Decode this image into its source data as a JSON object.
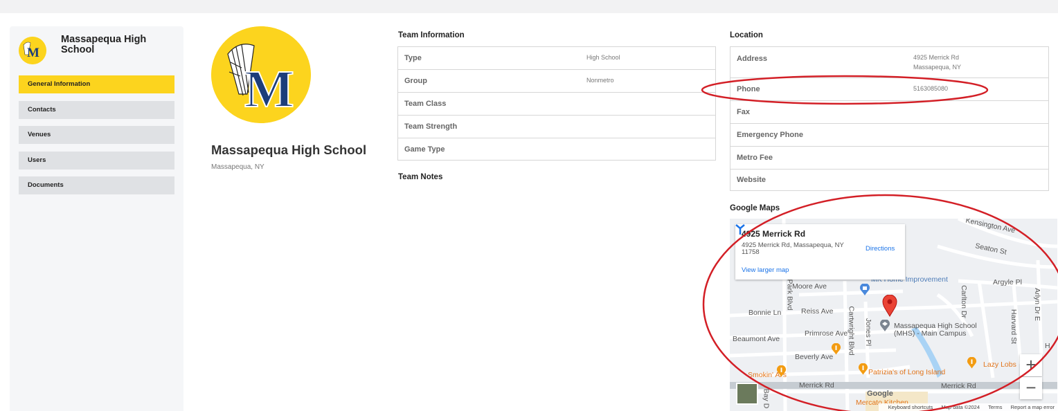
{
  "sidebar": {
    "title": "Massapequa High School",
    "items": [
      {
        "label": "General Information",
        "active": true
      },
      {
        "label": "Contacts",
        "active": false
      },
      {
        "label": "Venues",
        "active": false
      },
      {
        "label": "Users",
        "active": false
      },
      {
        "label": "Documents",
        "active": false
      }
    ]
  },
  "profile": {
    "name": "Massapequa High School",
    "city": "Massapequa, NY"
  },
  "team_info": {
    "title": "Team Information",
    "rows": [
      {
        "label": "Type",
        "value": "High School"
      },
      {
        "label": "Group",
        "value": "Nonmetro"
      },
      {
        "label": "Team Class",
        "value": ""
      },
      {
        "label": "Team Strength",
        "value": ""
      },
      {
        "label": "Game Type",
        "value": ""
      }
    ]
  },
  "team_notes": {
    "title": "Team Notes"
  },
  "location": {
    "title": "Location",
    "rows": [
      {
        "label": "Address",
        "value": "4925 Merrick Rd",
        "value2": "Massapequa, NY"
      },
      {
        "label": "Phone",
        "value": "5163085080"
      },
      {
        "label": "Fax",
        "value": ""
      },
      {
        "label": "Emergency Phone",
        "value": ""
      },
      {
        "label": "Metro Fee",
        "value": ""
      },
      {
        "label": "Website",
        "value": ""
      }
    ]
  },
  "map": {
    "title": "Google Maps",
    "card_title": "4925 Merrick Rd",
    "card_address": "4925 Merrick Rd, Massapequa, NY 11758",
    "directions": "Directions",
    "larger_map": "View larger map",
    "google": "Google",
    "labels": {
      "kensington": "Kensington Ave",
      "seaton": "Seaton St",
      "mk": "MK Home Improvement",
      "argyle": "Argyle Pl",
      "moore": "Moore Ave",
      "park": "Park Blvd",
      "carlton": "Carlton Dr",
      "arlyn": "Arlyn Dr E",
      "bonnie": "Bonnie Ln",
      "reiss": "Reiss Ave",
      "cartwright": "Cartwright Blvd",
      "jones": "Jones Pl",
      "mhs1": "Massapequa High School",
      "mhs2": "(MHS) - Main Campus",
      "harvard": "Harvard St",
      "beaumont": "Beaumont Ave",
      "primrose": "Primrose Ave",
      "beverly": "Beverly Ave",
      "lazy": "Lazy Lobs",
      "smokin": "Smokin' Al's",
      "patrizia": "Patrizia's of Long Island",
      "merrick1": "Merrick Rd",
      "merrick2": "Merrick Rd",
      "bay": "Bay D",
      "mercato": "Mercato Kitchen",
      "h": "H"
    },
    "attribution": {
      "shortcuts": "Keyboard shortcuts",
      "data": "Map data ©2024",
      "terms": "Terms",
      "report": "Report a map error"
    }
  },
  "colors": {
    "accent": "#fcd41e",
    "nav_bg": "#dfe1e4",
    "sidebar_bg": "#f5f6f8",
    "annotation": "#d31f26",
    "link": "#1a73e8"
  }
}
